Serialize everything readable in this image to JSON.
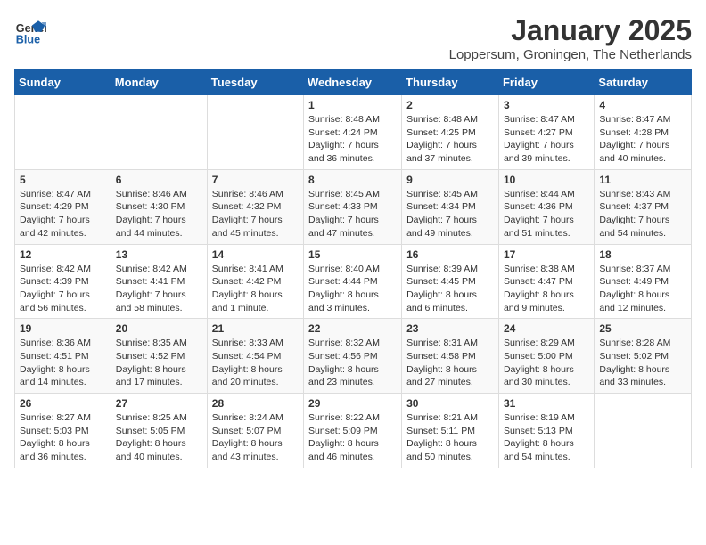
{
  "header": {
    "logo_general": "General",
    "logo_blue": "Blue",
    "month_title": "January 2025",
    "location": "Loppersum, Groningen, The Netherlands"
  },
  "weekdays": [
    "Sunday",
    "Monday",
    "Tuesday",
    "Wednesday",
    "Thursday",
    "Friday",
    "Saturday"
  ],
  "weeks": [
    [
      {
        "day": "",
        "content": ""
      },
      {
        "day": "",
        "content": ""
      },
      {
        "day": "",
        "content": ""
      },
      {
        "day": "1",
        "content": "Sunrise: 8:48 AM\nSunset: 4:24 PM\nDaylight: 7 hours\nand 36 minutes."
      },
      {
        "day": "2",
        "content": "Sunrise: 8:48 AM\nSunset: 4:25 PM\nDaylight: 7 hours\nand 37 minutes."
      },
      {
        "day": "3",
        "content": "Sunrise: 8:47 AM\nSunset: 4:27 PM\nDaylight: 7 hours\nand 39 minutes."
      },
      {
        "day": "4",
        "content": "Sunrise: 8:47 AM\nSunset: 4:28 PM\nDaylight: 7 hours\nand 40 minutes."
      }
    ],
    [
      {
        "day": "5",
        "content": "Sunrise: 8:47 AM\nSunset: 4:29 PM\nDaylight: 7 hours\nand 42 minutes."
      },
      {
        "day": "6",
        "content": "Sunrise: 8:46 AM\nSunset: 4:30 PM\nDaylight: 7 hours\nand 44 minutes."
      },
      {
        "day": "7",
        "content": "Sunrise: 8:46 AM\nSunset: 4:32 PM\nDaylight: 7 hours\nand 45 minutes."
      },
      {
        "day": "8",
        "content": "Sunrise: 8:45 AM\nSunset: 4:33 PM\nDaylight: 7 hours\nand 47 minutes."
      },
      {
        "day": "9",
        "content": "Sunrise: 8:45 AM\nSunset: 4:34 PM\nDaylight: 7 hours\nand 49 minutes."
      },
      {
        "day": "10",
        "content": "Sunrise: 8:44 AM\nSunset: 4:36 PM\nDaylight: 7 hours\nand 51 minutes."
      },
      {
        "day": "11",
        "content": "Sunrise: 8:43 AM\nSunset: 4:37 PM\nDaylight: 7 hours\nand 54 minutes."
      }
    ],
    [
      {
        "day": "12",
        "content": "Sunrise: 8:42 AM\nSunset: 4:39 PM\nDaylight: 7 hours\nand 56 minutes."
      },
      {
        "day": "13",
        "content": "Sunrise: 8:42 AM\nSunset: 4:41 PM\nDaylight: 7 hours\nand 58 minutes."
      },
      {
        "day": "14",
        "content": "Sunrise: 8:41 AM\nSunset: 4:42 PM\nDaylight: 8 hours\nand 1 minute."
      },
      {
        "day": "15",
        "content": "Sunrise: 8:40 AM\nSunset: 4:44 PM\nDaylight: 8 hours\nand 3 minutes."
      },
      {
        "day": "16",
        "content": "Sunrise: 8:39 AM\nSunset: 4:45 PM\nDaylight: 8 hours\nand 6 minutes."
      },
      {
        "day": "17",
        "content": "Sunrise: 8:38 AM\nSunset: 4:47 PM\nDaylight: 8 hours\nand 9 minutes."
      },
      {
        "day": "18",
        "content": "Sunrise: 8:37 AM\nSunset: 4:49 PM\nDaylight: 8 hours\nand 12 minutes."
      }
    ],
    [
      {
        "day": "19",
        "content": "Sunrise: 8:36 AM\nSunset: 4:51 PM\nDaylight: 8 hours\nand 14 minutes."
      },
      {
        "day": "20",
        "content": "Sunrise: 8:35 AM\nSunset: 4:52 PM\nDaylight: 8 hours\nand 17 minutes."
      },
      {
        "day": "21",
        "content": "Sunrise: 8:33 AM\nSunset: 4:54 PM\nDaylight: 8 hours\nand 20 minutes."
      },
      {
        "day": "22",
        "content": "Sunrise: 8:32 AM\nSunset: 4:56 PM\nDaylight: 8 hours\nand 23 minutes."
      },
      {
        "day": "23",
        "content": "Sunrise: 8:31 AM\nSunset: 4:58 PM\nDaylight: 8 hours\nand 27 minutes."
      },
      {
        "day": "24",
        "content": "Sunrise: 8:29 AM\nSunset: 5:00 PM\nDaylight: 8 hours\nand 30 minutes."
      },
      {
        "day": "25",
        "content": "Sunrise: 8:28 AM\nSunset: 5:02 PM\nDaylight: 8 hours\nand 33 minutes."
      }
    ],
    [
      {
        "day": "26",
        "content": "Sunrise: 8:27 AM\nSunset: 5:03 PM\nDaylight: 8 hours\nand 36 minutes."
      },
      {
        "day": "27",
        "content": "Sunrise: 8:25 AM\nSunset: 5:05 PM\nDaylight: 8 hours\nand 40 minutes."
      },
      {
        "day": "28",
        "content": "Sunrise: 8:24 AM\nSunset: 5:07 PM\nDaylight: 8 hours\nand 43 minutes."
      },
      {
        "day": "29",
        "content": "Sunrise: 8:22 AM\nSunset: 5:09 PM\nDaylight: 8 hours\nand 46 minutes."
      },
      {
        "day": "30",
        "content": "Sunrise: 8:21 AM\nSunset: 5:11 PM\nDaylight: 8 hours\nand 50 minutes."
      },
      {
        "day": "31",
        "content": "Sunrise: 8:19 AM\nSunset: 5:13 PM\nDaylight: 8 hours\nand 54 minutes."
      },
      {
        "day": "",
        "content": ""
      }
    ]
  ]
}
